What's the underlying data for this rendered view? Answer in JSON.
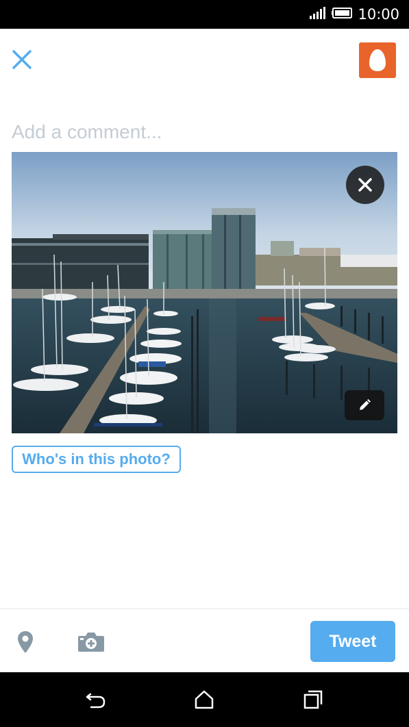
{
  "status_bar": {
    "time": "10:00",
    "battery_icon": "battery-full-icon",
    "signal_icon": "signal-icon"
  },
  "header": {
    "close_icon": "close-icon",
    "avatar_icon": "egg-avatar-icon"
  },
  "compose": {
    "comment_placeholder": "Add a comment..."
  },
  "photo": {
    "subject": "harbor-marina-photo",
    "remove_icon": "close-icon",
    "edit_icon": "pencil-icon",
    "tag_label": "Who's in this photo?"
  },
  "toolbar": {
    "location_icon": "location-pin-icon",
    "camera_icon": "camera-plus-icon",
    "tweet_label": "Tweet"
  },
  "nav_bar": {
    "back_icon": "back-icon",
    "home_icon": "home-icon",
    "recents_icon": "recents-icon"
  },
  "colors": {
    "accent": "#55acee",
    "avatar_bg": "#e8642a",
    "placeholder": "#c4ccd3",
    "icon_gray": "#8899a6"
  }
}
